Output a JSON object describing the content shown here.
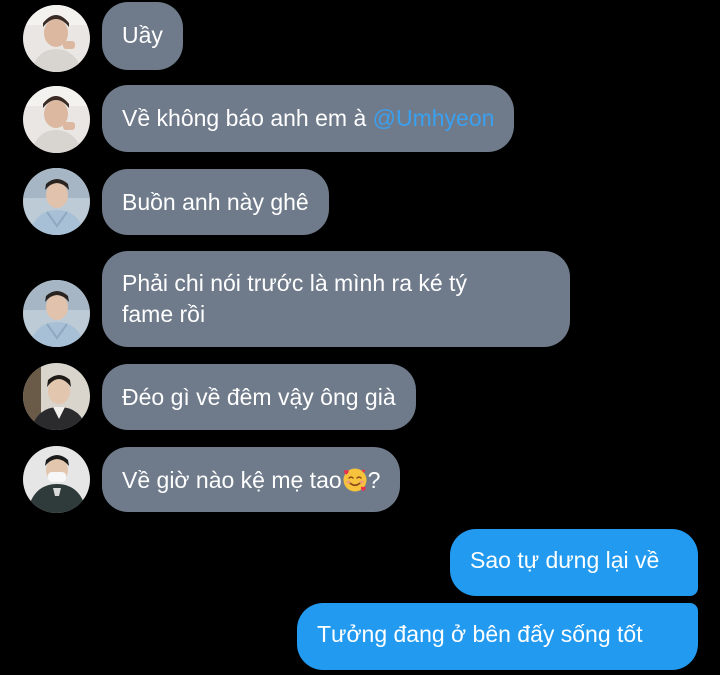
{
  "conversation": {
    "incoming": [
      {
        "sender": "avatar-a",
        "text": "Uầy"
      },
      {
        "sender": "avatar-a",
        "text": "Về không báo anh em à ",
        "mention": "@Umhyeon"
      },
      {
        "sender": "avatar-b",
        "text": "Buồn anh này ghê"
      },
      {
        "sender": "avatar-b",
        "lines": [
          "Phải chi nói trước là mình ra ké tý",
          "fame rồi"
        ]
      },
      {
        "sender": "avatar-c",
        "text": "Đéo gì về đêm vậy ông già"
      },
      {
        "sender": "avatar-d",
        "text_before": "Về giờ nào kệ mẹ tao",
        "emoji": "smiling-face-with-hearts",
        "text_after": "?"
      }
    ],
    "outgoing": [
      {
        "text": "Sao tự dưng lại về"
      },
      {
        "text": "Tưởng đang ở bên đấy sống tốt"
      }
    ]
  },
  "colors": {
    "background": "#000000",
    "incoming_bubble": "#6f7b8b",
    "outgoing_bubble": "#229af0",
    "mention": "#3aa0f0",
    "text": "#ffffff"
  }
}
